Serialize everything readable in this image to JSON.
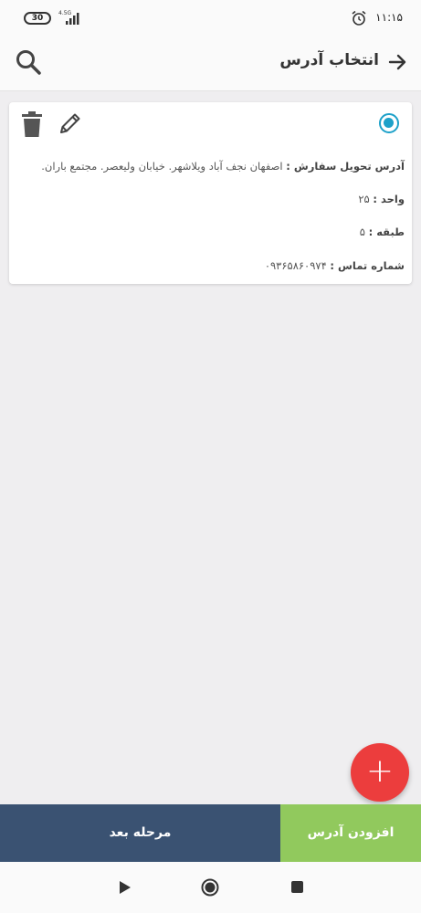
{
  "status_bar": {
    "battery": "30",
    "network": "4.5G",
    "time": "۱۱:۱۵"
  },
  "header": {
    "title": "انتخاب آدرس"
  },
  "address_card": {
    "address_label": "آدرس تحویل سفارش :",
    "address_value": "اصفهان نجف آباد ویلاشهر. خیابان ولیعصر. مجتمع باران.",
    "unit_label": "واحد :",
    "unit_value": "۲۵",
    "floor_label": "طبقه :",
    "floor_value": "۵",
    "phone_label": "شماره تماس :",
    "phone_value": "۰۹۳۶۵۸۶۰۹۷۴",
    "selected": true
  },
  "fab": {
    "label": "+"
  },
  "buttons": {
    "next_label": "مرحله بعد",
    "add_label": "افزودن آدرس"
  },
  "colors": {
    "accent": "#1da1c9",
    "fab": "#ec3d3d",
    "next_button": "#3a5272",
    "add_button": "#91c95d"
  }
}
